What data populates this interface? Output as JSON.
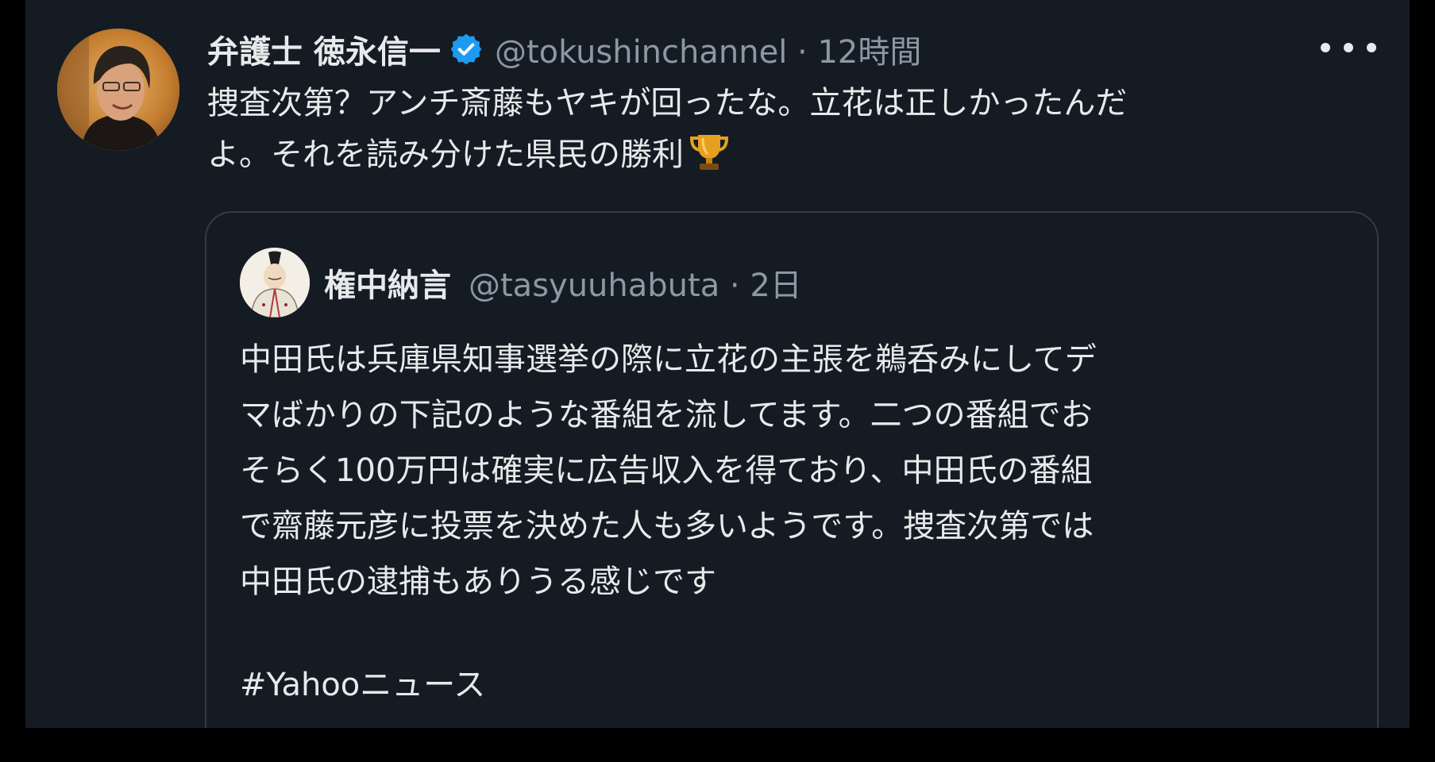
{
  "tweet": {
    "display_name": "弁護士 徳永信一",
    "handle_meta": "@tokushinchannel · 12時間",
    "body_lines": [
      "捜査次第？アンチ斎藤もヤキが回ったな。立花は正しかったんだ",
      "よ。それを読み分けた県民の勝利"
    ],
    "trophy_icon": "trophy-emoji",
    "verified_icon": "verified-badge",
    "verified_color": "#1d9bf0"
  },
  "quote": {
    "display_name": "権中納言",
    "handle_meta": "@tasyuuhabuta · 2日",
    "lines": [
      "中田氏は兵庫県知事選挙の際に立花の主張を鵜呑みにしてデ",
      "マばかりの下記のような番組を流してます。二つの番組でお",
      "そらく100万円は確実に広告収入を得ており、中田氏の番組",
      "で齋藤元彦に投票を決めた人も多いようです。捜査次第では",
      "中田氏の逮捕もありうる感じです"
    ],
    "hashtag": "#Yahooニュース"
  },
  "colors": {
    "background": "#151b23",
    "text": "#e7e9ea",
    "secondary": "#8b98a5",
    "border": "#333b44"
  }
}
